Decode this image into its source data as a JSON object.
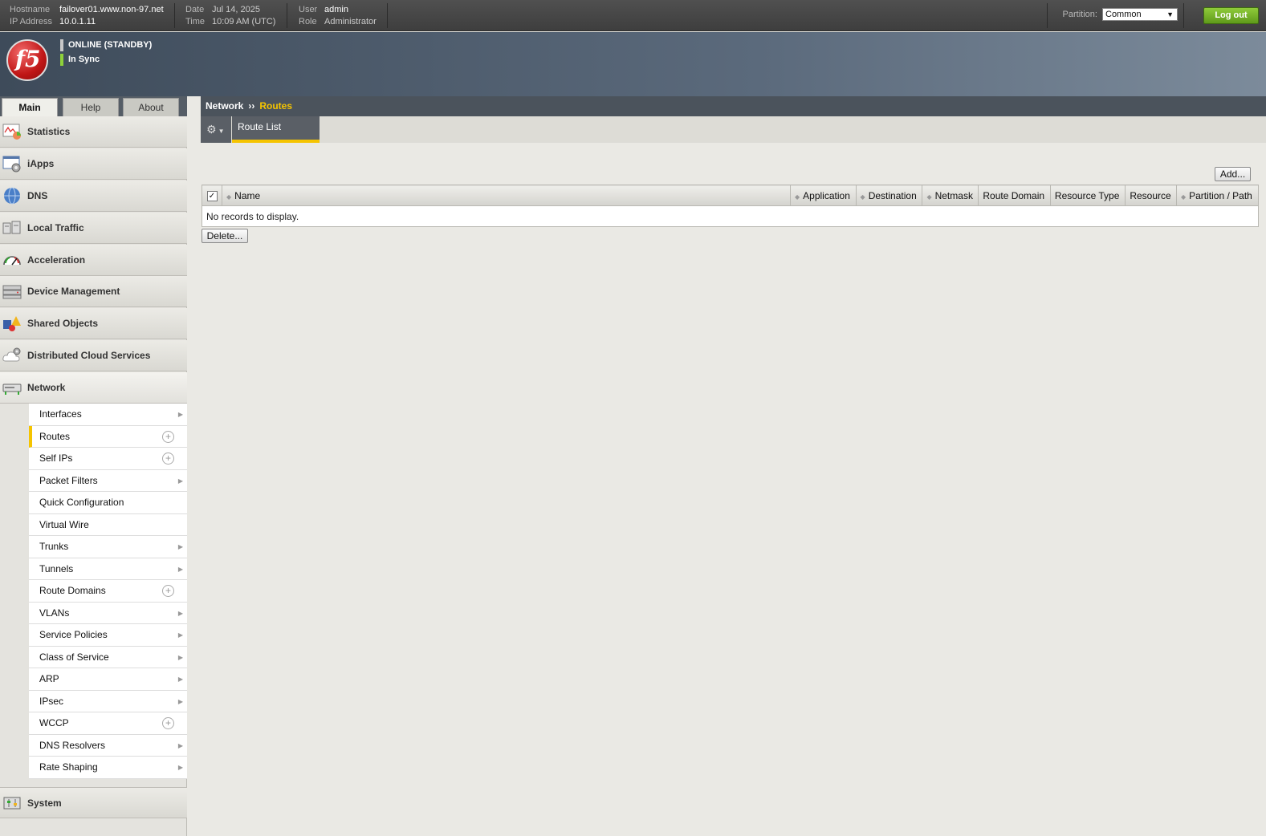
{
  "topbar": {
    "hostname_label": "Hostname",
    "hostname": "failover01.www.non-97.net",
    "ip_label": "IP Address",
    "ip": "10.0.1.11",
    "date_label": "Date",
    "date": "Jul 14, 2025",
    "time_label": "Time",
    "time": "10:09 AM (UTC)",
    "user_label": "User",
    "user": "admin",
    "role_label": "Role",
    "role": "Administrator",
    "partition_label": "Partition:",
    "partition_value": "Common",
    "logout_label": "Log out"
  },
  "banner": {
    "logo_text": "f5",
    "status_online": "ONLINE (STANDBY)",
    "status_sync": "In Sync",
    "status_colors": {
      "online": "#c8c8c8",
      "sync": "#8ed13a"
    }
  },
  "tabs": [
    {
      "label": "Main",
      "active": true
    },
    {
      "label": "Help",
      "active": false
    },
    {
      "label": "About",
      "active": false
    }
  ],
  "sidebar": {
    "items": [
      {
        "label": "Statistics",
        "icon": "statistics-chart-icon"
      },
      {
        "label": "iApps",
        "icon": "iapps-window-gear-icon"
      },
      {
        "label": "DNS",
        "icon": "globe-icon"
      },
      {
        "label": "Local Traffic",
        "icon": "servers-icon"
      },
      {
        "label": "Acceleration",
        "icon": "speedometer-icon"
      },
      {
        "label": "Device Management",
        "icon": "device-stack-icon"
      },
      {
        "label": "Shared Objects",
        "icon": "shapes-icon"
      },
      {
        "label": "Distributed Cloud Services",
        "icon": "cloud-gear-icon"
      },
      {
        "label": "Network",
        "icon": "network-device-icon"
      }
    ],
    "network_sub": [
      {
        "label": "Interfaces",
        "mark": "arrow"
      },
      {
        "label": "Routes",
        "mark": "plus",
        "active": true
      },
      {
        "label": "Self IPs",
        "mark": "plus"
      },
      {
        "label": "Packet Filters",
        "mark": "arrow"
      },
      {
        "label": "Quick Configuration",
        "mark": "none"
      },
      {
        "label": "Virtual Wire",
        "mark": "none"
      },
      {
        "label": "Trunks",
        "mark": "arrow"
      },
      {
        "label": "Tunnels",
        "mark": "arrow"
      },
      {
        "label": "Route Domains",
        "mark": "plus"
      },
      {
        "label": "VLANs",
        "mark": "arrow"
      },
      {
        "label": "Service Policies",
        "mark": "arrow"
      },
      {
        "label": "Class of Service",
        "mark": "arrow"
      },
      {
        "label": "ARP",
        "mark": "arrow"
      },
      {
        "label": "IPsec",
        "mark": "arrow"
      },
      {
        "label": "WCCP",
        "mark": "plus"
      },
      {
        "label": "DNS Resolvers",
        "mark": "arrow"
      },
      {
        "label": "Rate Shaping",
        "mark": "arrow"
      }
    ],
    "system_label": "System",
    "system_icon": "system-settings-icon"
  },
  "breadcrumb": {
    "parent": "Network",
    "separator": "››",
    "current": "Routes"
  },
  "content": {
    "tab_route_list": "Route List",
    "add_button": "Add...",
    "delete_button": "Delete...",
    "empty_message": "No records to display.",
    "columns": [
      "Name",
      "Application",
      "Destination",
      "Netmask",
      "Route Domain",
      "Resource Type",
      "Resource",
      "Partition / Path"
    ],
    "sortable": [
      true,
      true,
      true,
      true,
      false,
      false,
      false,
      true
    ]
  },
  "colors": {
    "accent": "#f5c400",
    "logout_green": "#6fae22",
    "header_dark": "#4b535c"
  }
}
